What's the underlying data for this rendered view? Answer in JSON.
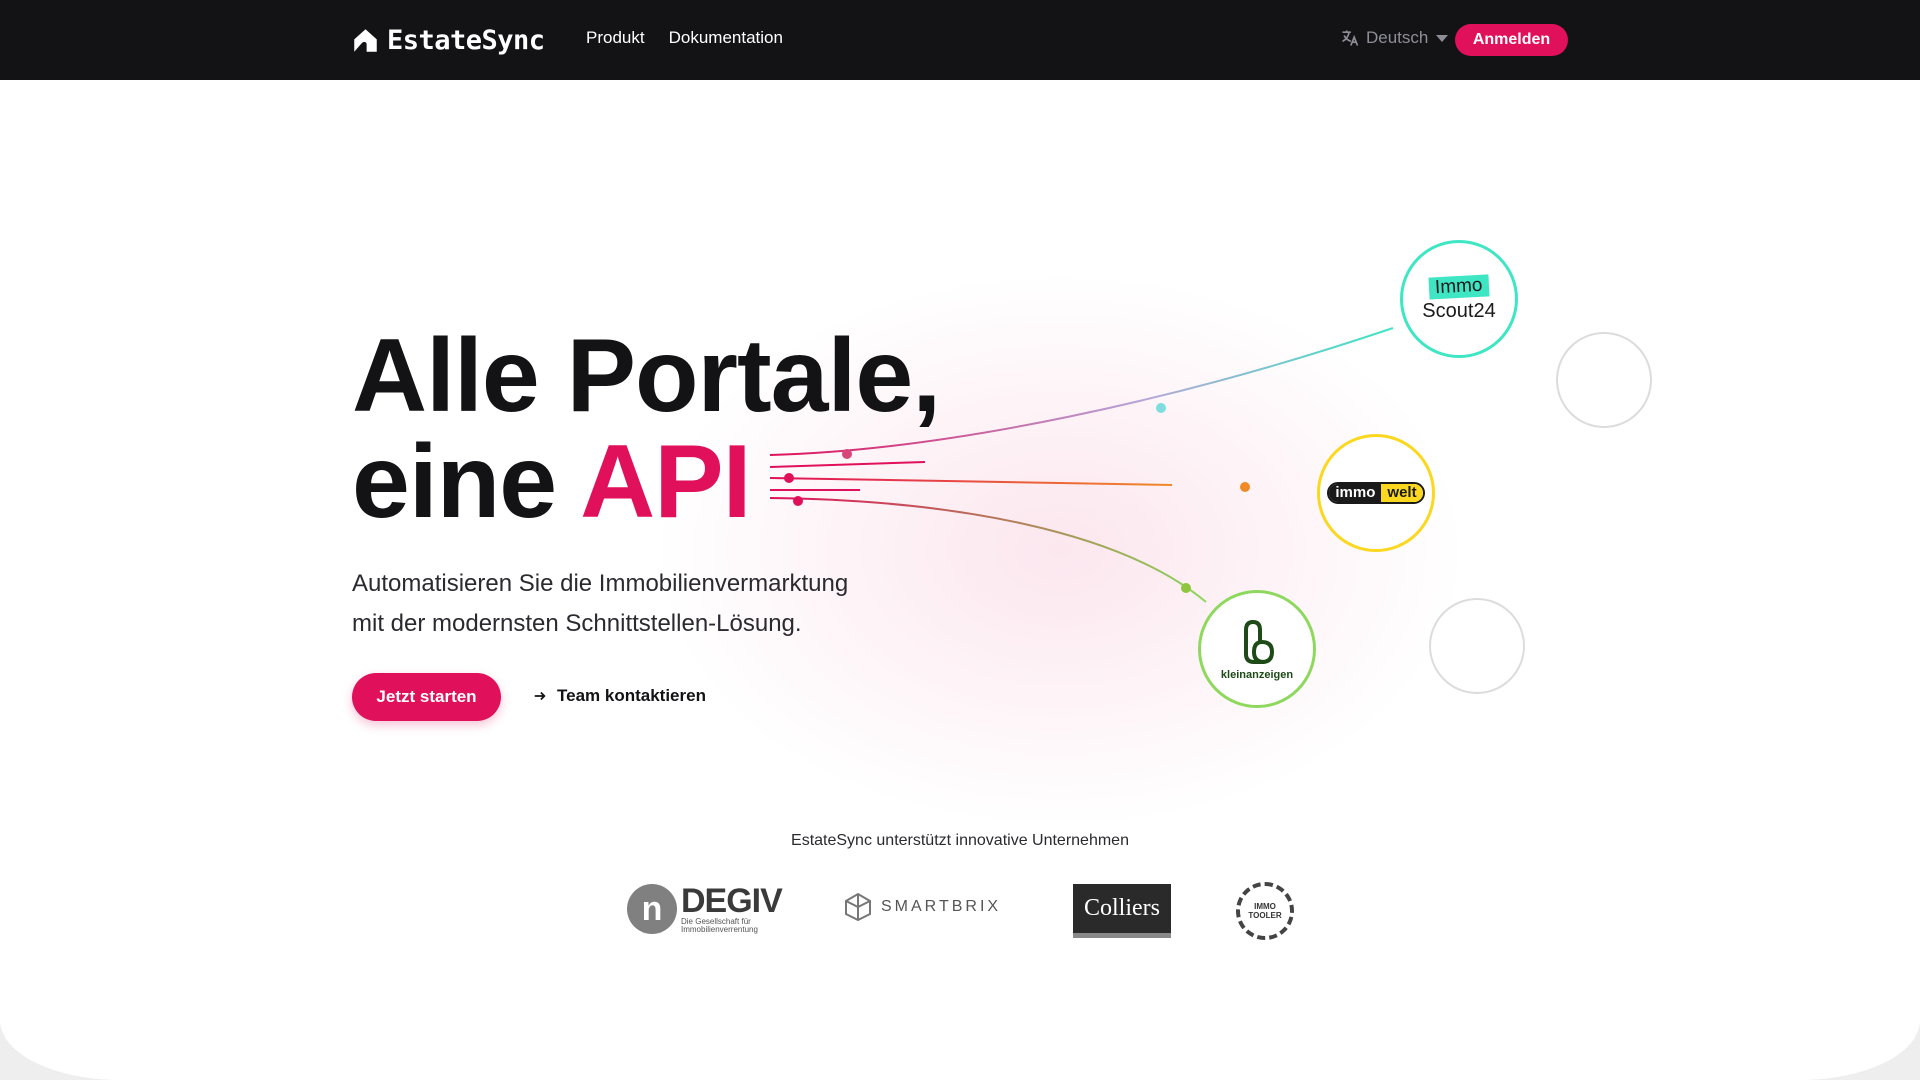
{
  "colors": {
    "accent": "#e0105a",
    "nav_bg": "#131316",
    "scout": "#3ee6c4",
    "welt": "#fbd81f",
    "klein": "#8ed85e"
  },
  "navbar": {
    "brand": "EstateSync",
    "brand_icon": "house-logo-icon",
    "links": [
      "Produkt",
      "Dokumentation"
    ],
    "language": {
      "icon": "translate-icon",
      "label": "Deutsch"
    },
    "login_label": "Anmelden"
  },
  "hero": {
    "title_line1": "Alle Portale,",
    "title_line2_prefix": "eine",
    "title_line2_accent": "API",
    "subtitle_line1": "Automatisieren Sie die Immobilienvermarktung",
    "subtitle_line2": "mit der modernsten Schnittstellen-Lösung.",
    "cta_primary": "Jetzt starten",
    "cta_secondary": "Team kontaktieren"
  },
  "portals": {
    "scout": {
      "badge": "Immo",
      "text": "Scout24"
    },
    "welt": {
      "left": "immo",
      "right": "welt"
    },
    "klein": {
      "text": "kleinanzeigen"
    }
  },
  "supporters": {
    "heading": "EstateSync unterstützt innovative Unternehmen",
    "degiv": {
      "mark": "n",
      "name": "DEGIV",
      "tagline": "Die Gesellschaft für Immobilienverrentung"
    },
    "smartbrix": {
      "name": "SMARTBRIX"
    },
    "colliers": {
      "name": "Colliers"
    },
    "immotooler": {
      "line1": "IMMO",
      "line2": "TOOLER"
    }
  }
}
